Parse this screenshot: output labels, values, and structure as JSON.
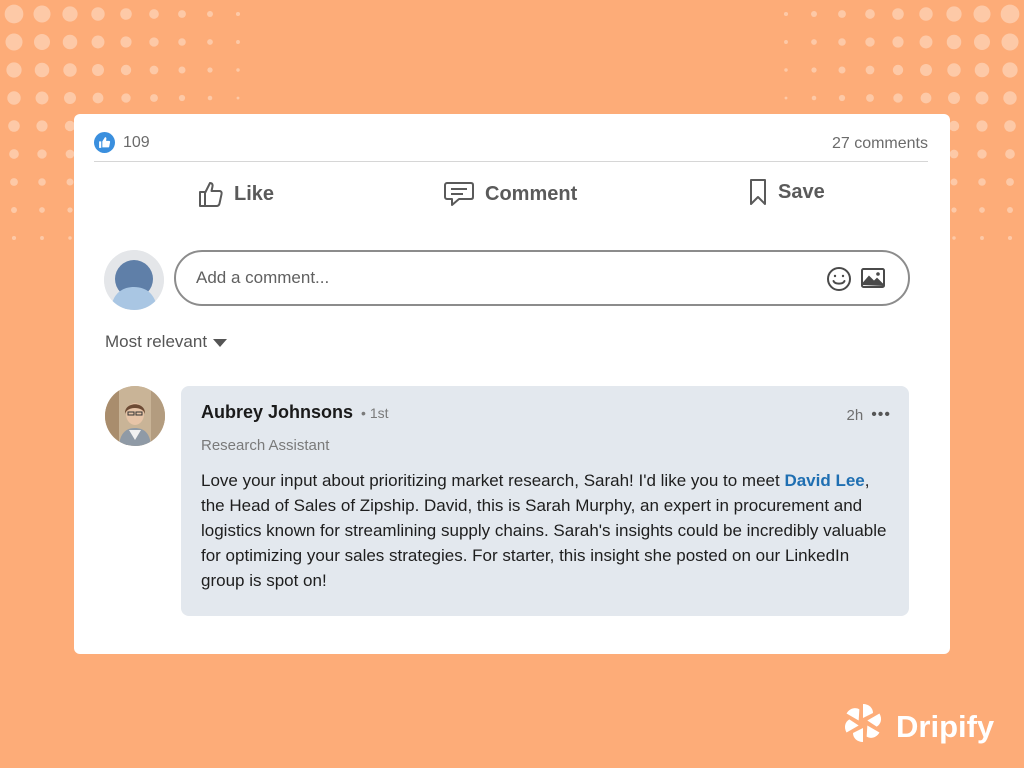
{
  "stats": {
    "reaction_count": "109",
    "comments_count": "27 comments"
  },
  "actions": {
    "like_label": "Like",
    "comment_label": "Comment",
    "save_label": "Save"
  },
  "composer": {
    "placeholder": "Add a comment..."
  },
  "sort": {
    "label": "Most relevant"
  },
  "comment": {
    "author_name": "Aubrey Johnsons",
    "degree": "• 1st",
    "headline": "Research Assistant",
    "time": "2h",
    "more": "•••",
    "text_before": "Love your input about prioritizing market research, Sarah! I'd like you to meet ",
    "mention": "David Lee",
    "text_after": ", the Head of Sales of Zipship. David, this is Sarah Murphy, an expert in procurement and logistics known for streamlining supply chains. Sarah's insights could be incredibly valuable for optimizing your sales strategies. For starter, this insight she posted on our LinkedIn group is spot on!"
  },
  "brand": {
    "name": "Dripify"
  },
  "colors": {
    "background": "#fdac78",
    "like_badge": "#3a8fde",
    "mention": "#1f6fb2",
    "bubble": "#e3e8ee"
  }
}
